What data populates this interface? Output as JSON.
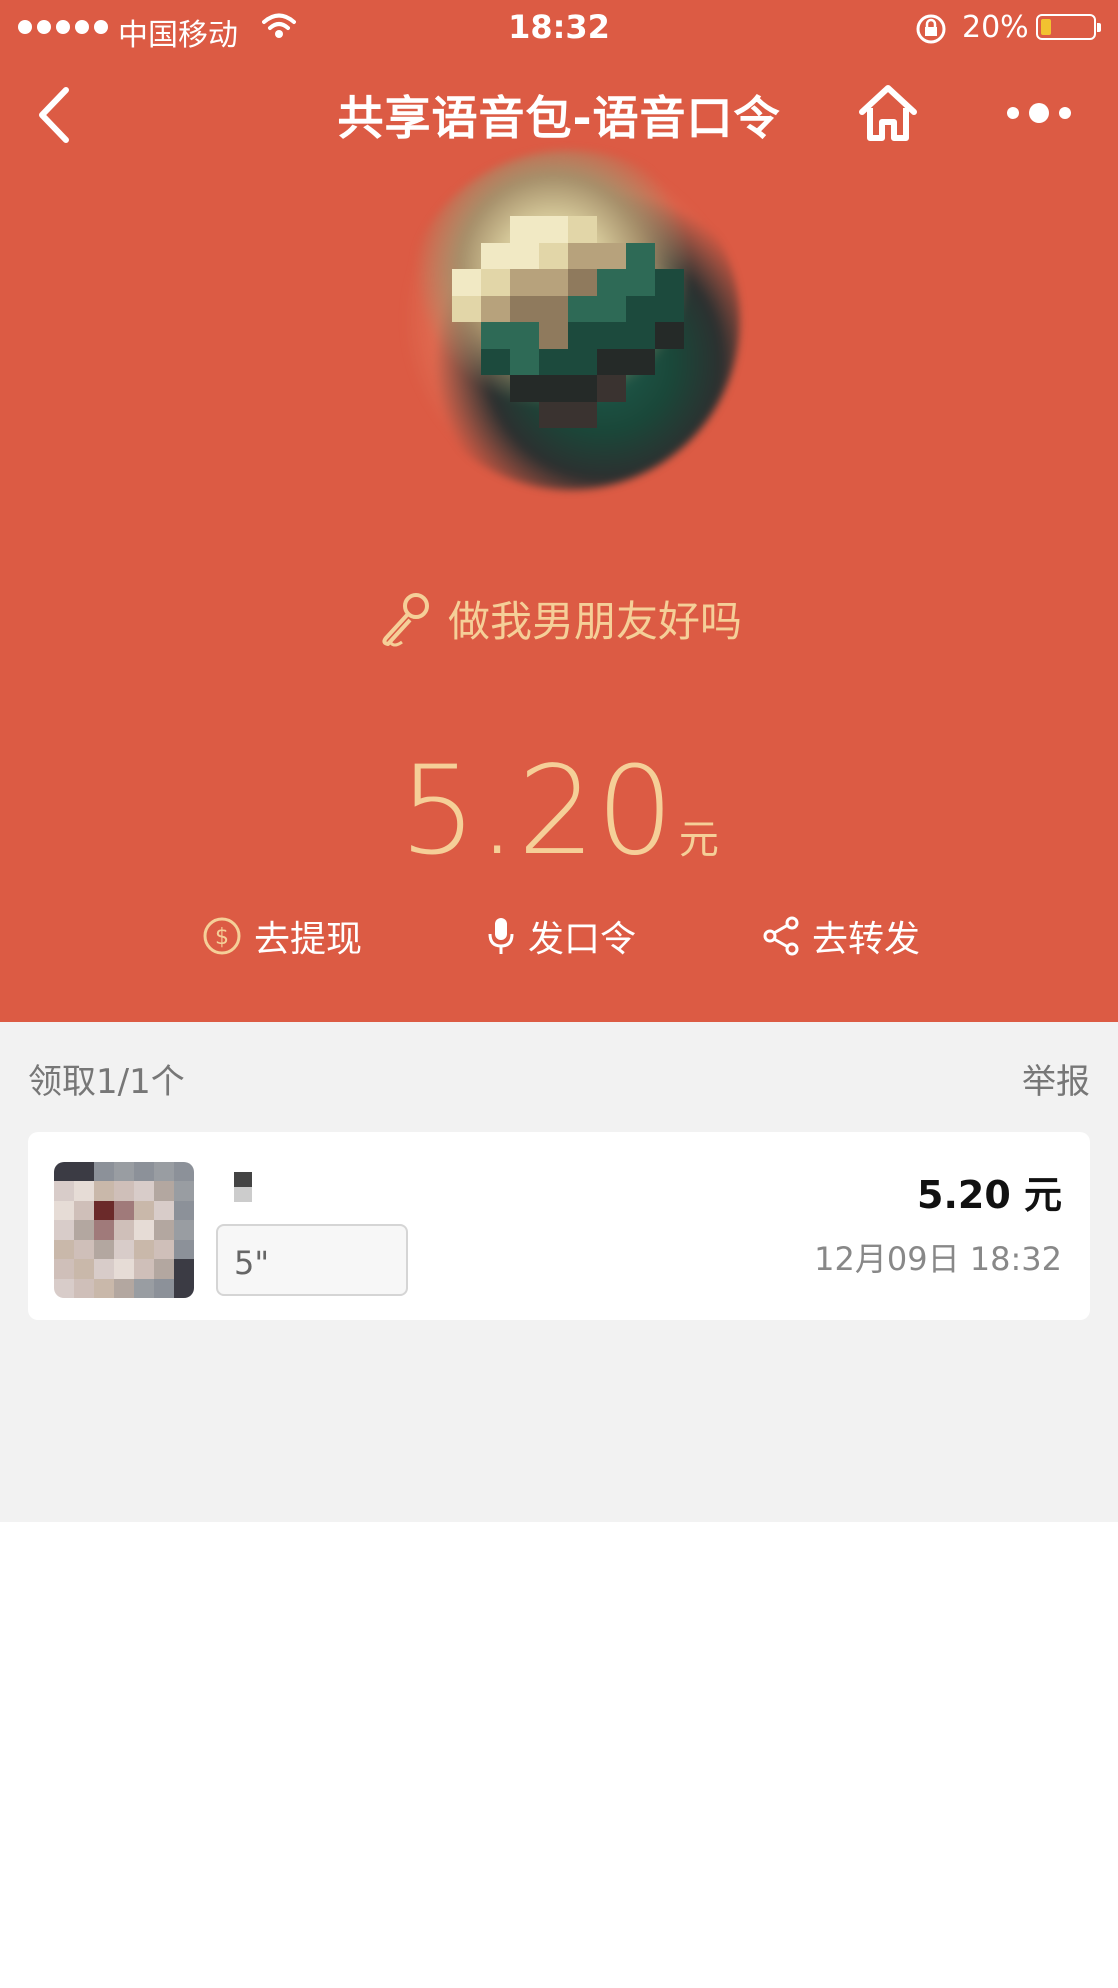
{
  "status_bar": {
    "carrier": "中国移动",
    "time": "18:32",
    "battery": "20%",
    "battery_level": 0.2
  },
  "nav": {
    "title": "共享语音包-语音口令"
  },
  "envelope": {
    "slogan": "做我男朋友好吗",
    "amount": "5.20",
    "unit": "元"
  },
  "actions": [
    {
      "label": "去提现",
      "icon": "dollar-circle-icon"
    },
    {
      "label": "发口令",
      "icon": "microphone-icon"
    },
    {
      "label": "去转发",
      "icon": "share-icon"
    }
  ],
  "list": {
    "claimed": "领取1/1个",
    "report": "举报",
    "items": [
      {
        "voice_duration": "5\"",
        "amount": "5.20 元",
        "time": "12月09日 18:32"
      }
    ]
  },
  "colors": {
    "accent": "#dc5b44",
    "gold": "#f5cf98"
  }
}
